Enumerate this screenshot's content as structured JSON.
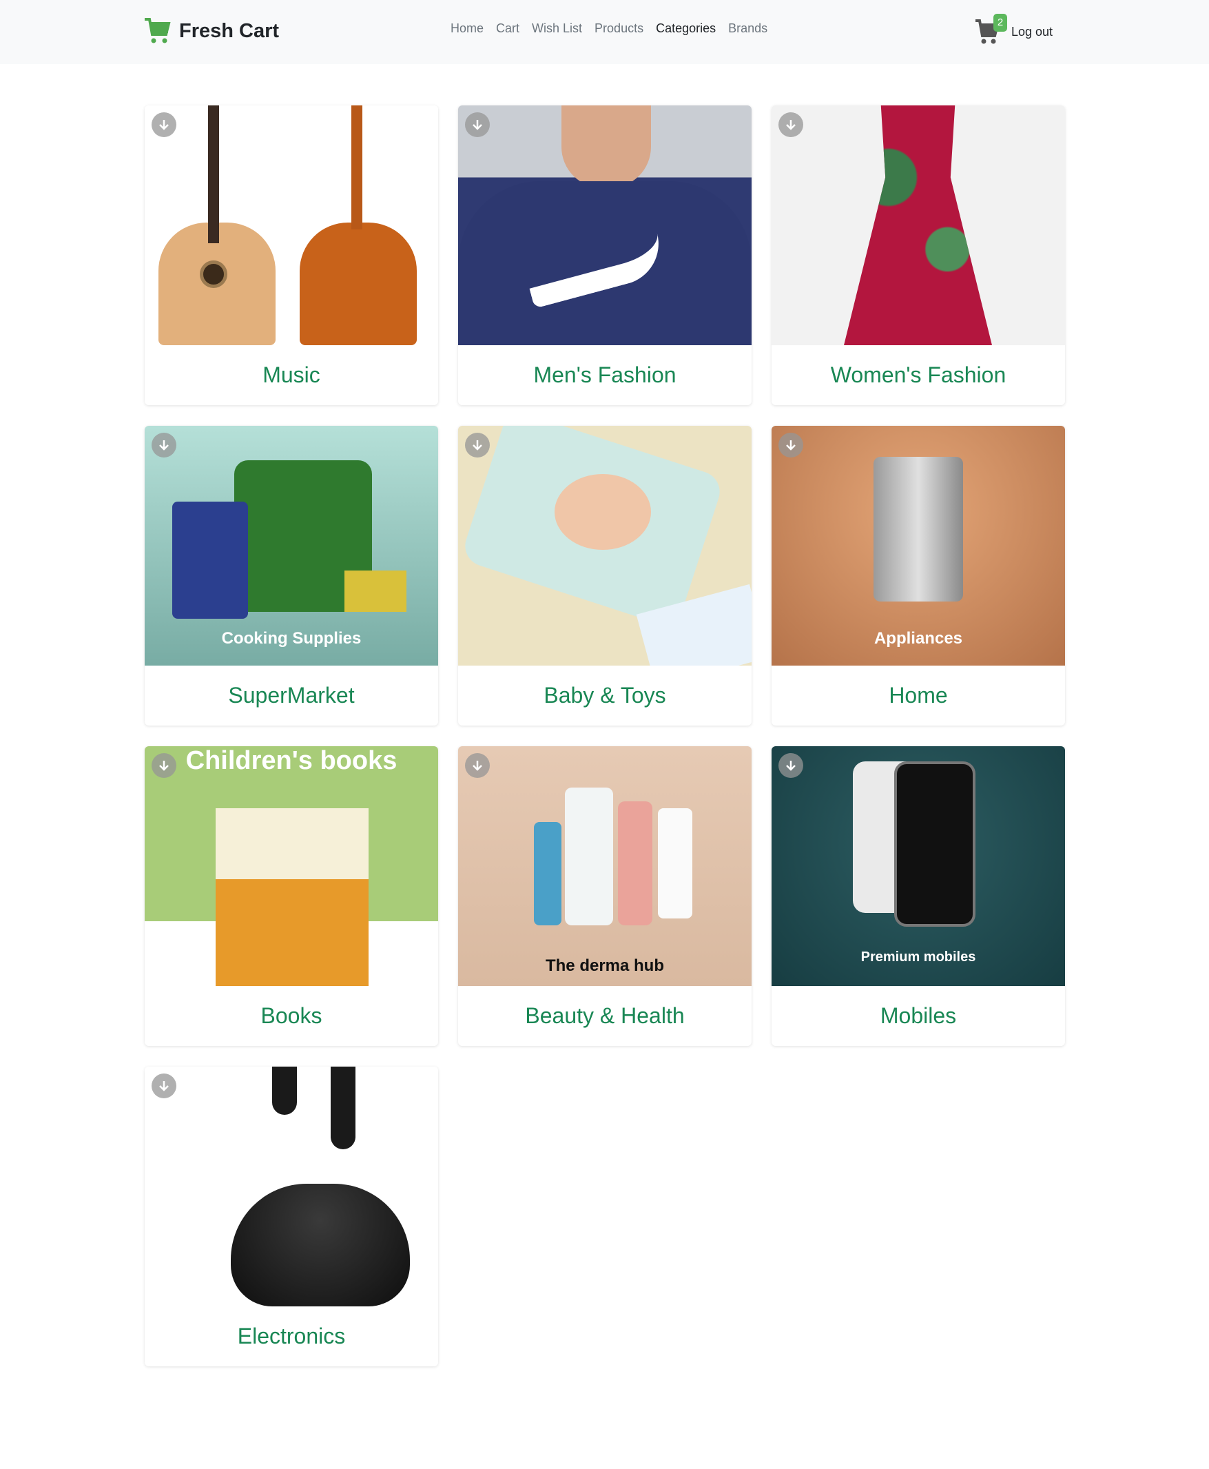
{
  "brand": {
    "name": "Fresh Cart",
    "color": "#4fa94d"
  },
  "nav": {
    "links": [
      "Home",
      "Cart",
      "Wish List",
      "Products",
      "Categories",
      "Brands"
    ],
    "active": "Categories"
  },
  "cart": {
    "count": "2"
  },
  "logout": "Log out",
  "accent": "#198754",
  "categories": [
    {
      "name": "Music"
    },
    {
      "name": "Men's Fashion"
    },
    {
      "name": "Women's Fashion"
    },
    {
      "name": "SuperMarket",
      "caption": "Cooking Supplies"
    },
    {
      "name": "Baby & Toys"
    },
    {
      "name": "Home",
      "caption": "Appliances"
    },
    {
      "name": "Books",
      "caption": "Children's books"
    },
    {
      "name": "Beauty & Health",
      "caption": "The derma hub"
    },
    {
      "name": "Mobiles",
      "caption": "Premium mobiles"
    },
    {
      "name": "Electronics"
    }
  ]
}
